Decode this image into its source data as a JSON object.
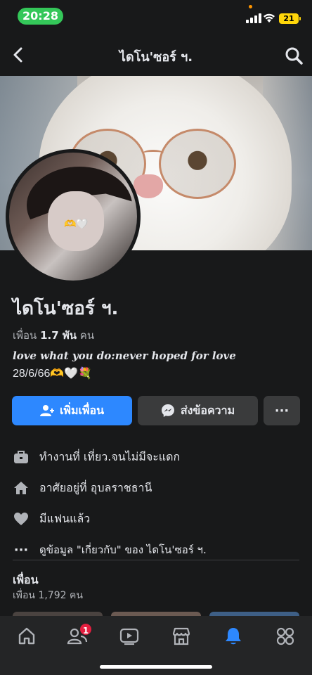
{
  "status_bar": {
    "time": "20:28",
    "battery": "21"
  },
  "header": {
    "title": "ไดโน'ซอร์ ฯ."
  },
  "profile": {
    "name": "ไดโน'ซอร์ ฯ.",
    "friends_prefix": "เพื่อน",
    "friends_count": "1.7 พัน",
    "friends_suffix": "คน",
    "bio_line1": "love what you do:never hoped for love",
    "bio_line2": "28/6/66🫶🤍💐"
  },
  "actions": {
    "add_friend": "เพิ่มเพื่อน",
    "message": "ส่งข้อความ",
    "more": "···"
  },
  "details": [
    {
      "icon": "briefcase-icon",
      "text": "ทำงานที่ เที่ยว.จนไม่มีจะแดก"
    },
    {
      "icon": "home-icon",
      "text": "อาศัยอยู่ที่ อุบลราชธานี"
    },
    {
      "icon": "heart-icon",
      "text": "มีแฟนแล้ว"
    },
    {
      "icon": "ellipsis-icon",
      "text": "ดูข้อมูล \"เกี่ยวกับ\" ของ ไดโน'ซอร์ ฯ."
    }
  ],
  "friends_section": {
    "title": "เพื่อน",
    "count": "เพื่อน 1,792 คน"
  },
  "tab_bar": {
    "tabs": [
      "home-icon",
      "friends-icon",
      "video-icon",
      "marketplace-icon",
      "notifications-icon",
      "menu-icon"
    ],
    "friends_badge": "1",
    "accent_color": "#2d88ff"
  }
}
